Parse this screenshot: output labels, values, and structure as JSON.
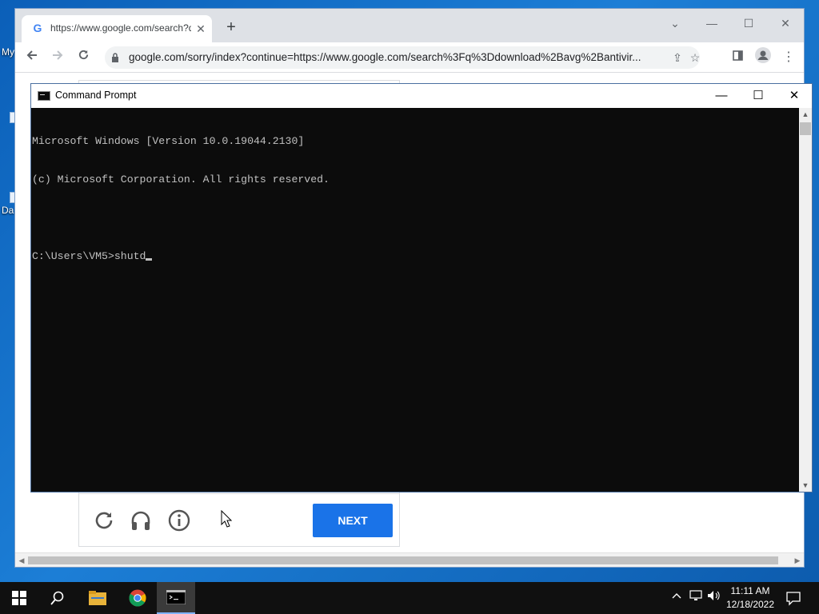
{
  "desktop": {
    "icons": [
      {
        "label": "My"
      },
      {
        "label": ""
      },
      {
        "label": "Da"
      }
    ]
  },
  "browser": {
    "tab_title": "https://www.google.com/search?q=download+avg+antivirus",
    "address": "google.com/sorry/index?continue=https://www.google.com/search%3Fq%3Ddownload%2Bavg%2Bantivir...",
    "captcha": {
      "next_label": "NEXT"
    }
  },
  "cmd": {
    "title": "Command Prompt",
    "lines": [
      "Microsoft Windows [Version 10.0.19044.2130]",
      "(c) Microsoft Corporation. All rights reserved.",
      "",
      "C:\\Users\\VM5>shutd"
    ]
  },
  "taskbar": {
    "time": "11:11 AM",
    "date": "12/18/2022"
  },
  "colors": {
    "accent": "#1a73e8",
    "console_bg": "#0c0c0c",
    "console_fg": "#c0c0c0",
    "taskbar": "#101010"
  },
  "icons": [
    "windows-start-icon",
    "search-icon",
    "file-explorer-icon",
    "chrome-icon",
    "command-prompt-icon",
    "reload-icon",
    "audio-challenge-icon",
    "info-icon",
    "lock-icon",
    "share-icon",
    "star-icon",
    "side-panel-icon",
    "profile-icon",
    "menu-icon",
    "network-icon",
    "volume-icon",
    "notification-icon"
  ]
}
